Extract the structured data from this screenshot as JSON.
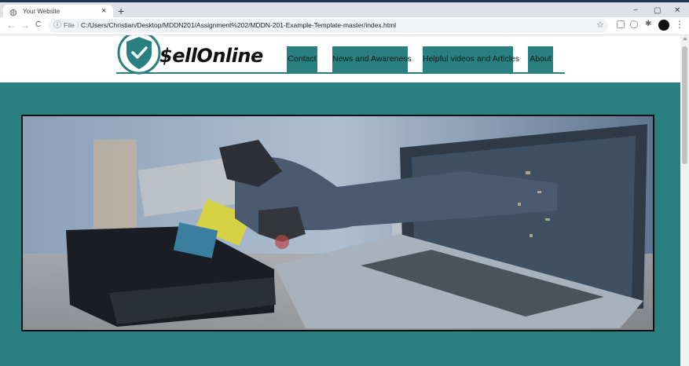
{
  "browser": {
    "tab_title": "Your Website",
    "tab_close": "×",
    "new_tab": "+",
    "window_controls": {
      "minimize": "−",
      "maximize": "▢",
      "close": "✕"
    },
    "nav": {
      "back": "←",
      "forward": "→",
      "reload": "C"
    },
    "scheme_label": "File",
    "separator": "|",
    "url": "C:/Users/Christian/Desktop/MDDN201/Assignment%202/MDDN-201-Example-Template-master/index.html",
    "icons": {
      "favicon": "globe-icon",
      "info": "info-icon",
      "bookmark": "star-icon",
      "extensions": "puzzle-icon",
      "menu": "kebab-menu-icon"
    },
    "glyphs": {
      "favicon": "◍",
      "info": "ⓘ",
      "star": "☆",
      "puzzle": "✱",
      "menu": "⋮"
    }
  },
  "site": {
    "logo_text": "$ellOnline",
    "nav": [
      {
        "label": "Contact"
      },
      {
        "label": "News and Awareness"
      },
      {
        "label": "Helpful videos and Articles"
      },
      {
        "label": "About"
      }
    ],
    "hero_image": "hand reaching out of laptop stealing credit card",
    "colors": {
      "accent": "#2a8080",
      "header_line": "#2a7f80",
      "logo_text": "#111111"
    }
  }
}
